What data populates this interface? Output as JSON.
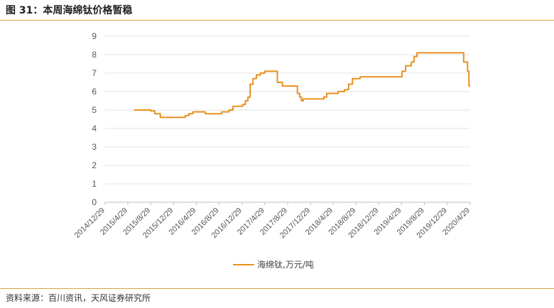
{
  "header": {
    "title": "图 31：本周海绵钛价格暂稳"
  },
  "footer": {
    "source": "资料来源：百川资讯，天风证券研究所"
  },
  "colors": {
    "series": "#e8901c",
    "grid": "#e3e3e3",
    "axis": "#bfbfbf",
    "rule": "#d9a441"
  },
  "chart_data": {
    "type": "line",
    "title": "",
    "xlabel": "",
    "ylabel": "",
    "ylim": [
      0,
      9
    ],
    "yticks": [
      0,
      1,
      2,
      3,
      4,
      5,
      6,
      7,
      8,
      9
    ],
    "xlim": [
      "2014-12-29",
      "2020-04-29"
    ],
    "xticks": [
      "2014/12/29",
      "2015/4/29",
      "2015/8/29",
      "2015/12/29",
      "2016/4/29",
      "2016/8/29",
      "2016/12/29",
      "2017/4/29",
      "2017/8/29",
      "2017/12/29",
      "2018/4/29",
      "2018/8/29",
      "2018/12/29",
      "2019/4/29",
      "2019/8/29",
      "2019/12/29",
      "2020/4/29"
    ],
    "grid": true,
    "legend": "bottom",
    "series": [
      {
        "name": "海绵钛,万元/吨",
        "step": true,
        "points": [
          [
            "2015-06-01",
            5.0
          ],
          [
            "2015-08-15",
            5.0
          ],
          [
            "2015-08-29",
            4.95
          ],
          [
            "2015-09-20",
            4.8
          ],
          [
            "2015-10-20",
            4.6
          ],
          [
            "2016-02-15",
            4.6
          ],
          [
            "2016-03-01",
            4.7
          ],
          [
            "2016-03-20",
            4.8
          ],
          [
            "2016-04-10",
            4.9
          ],
          [
            "2016-06-15",
            4.8
          ],
          [
            "2016-09-10",
            4.9
          ],
          [
            "2016-10-20",
            5.0
          ],
          [
            "2016-11-10",
            5.2
          ],
          [
            "2017-01-01",
            5.3
          ],
          [
            "2017-01-15",
            5.5
          ],
          [
            "2017-01-29",
            5.7
          ],
          [
            "2017-02-10",
            6.4
          ],
          [
            "2017-02-25",
            6.7
          ],
          [
            "2017-03-15",
            6.9
          ],
          [
            "2017-04-05",
            7.0
          ],
          [
            "2017-04-29",
            7.1
          ],
          [
            "2017-06-25",
            7.1
          ],
          [
            "2017-07-05",
            6.5
          ],
          [
            "2017-08-01",
            6.3
          ],
          [
            "2017-10-10",
            6.3
          ],
          [
            "2017-10-20",
            5.9
          ],
          [
            "2017-11-01",
            5.7
          ],
          [
            "2017-11-10",
            5.5
          ],
          [
            "2017-11-20",
            5.6
          ],
          [
            "2018-03-01",
            5.6
          ],
          [
            "2018-03-10",
            5.7
          ],
          [
            "2018-03-25",
            5.9
          ],
          [
            "2018-05-15",
            5.9
          ],
          [
            "2018-05-25",
            6.0
          ],
          [
            "2018-06-29",
            6.1
          ],
          [
            "2018-07-20",
            6.4
          ],
          [
            "2018-08-10",
            6.7
          ],
          [
            "2018-09-20",
            6.8
          ],
          [
            "2019-04-15",
            6.8
          ],
          [
            "2019-05-01",
            7.1
          ],
          [
            "2019-05-20",
            7.4
          ],
          [
            "2019-06-20",
            7.6
          ],
          [
            "2019-07-05",
            7.9
          ],
          [
            "2019-07-20",
            8.1
          ],
          [
            "2020-03-15",
            8.1
          ],
          [
            "2020-03-25",
            7.6
          ],
          [
            "2020-04-15",
            7.1
          ],
          [
            "2020-04-22",
            6.3
          ],
          [
            "2020-04-29",
            6.3
          ]
        ]
      }
    ]
  }
}
